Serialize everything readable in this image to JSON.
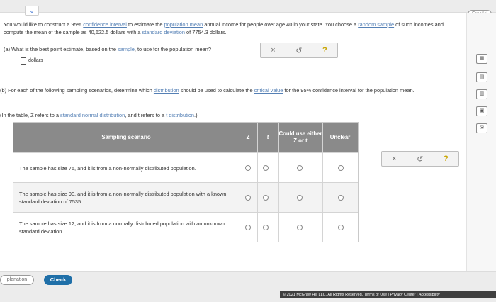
{
  "header": {
    "language_button": "Español"
  },
  "intro": {
    "p1": "You would like to construct a 95% ",
    "link1": "confidence interval",
    "p2": " to estimate the ",
    "link2": "population mean",
    "p3": " annual income for people over age 40 in your state. You choose a ",
    "link3": "random sample",
    "p4": " of such incomes and compute the mean of the sample as 40,622.5 dollars with a ",
    "link4": "standard deviation",
    "p5": " of 7754.3 dollars."
  },
  "part_a": {
    "q1": "(a) What is the best point estimate, based on the ",
    "link": "sample",
    "q2": ", to use for the population mean?",
    "unit": "dollars"
  },
  "tools": {
    "clear": "×",
    "undo": "↺",
    "help": "?"
  },
  "part_b": {
    "q1": "(b) For each of the following sampling scenarios, determine which ",
    "link1": "distribution",
    "q2": " should be used to calculate the ",
    "link2": "critical value",
    "q3": " for the 95% confidence interval for the population mean.",
    "note1": "(In the table, Z refers to a ",
    "note_link1": "standard normal distribution",
    "note2": ", and t refers to a ",
    "note_link2": "t distribution",
    "note3": ".)"
  },
  "table": {
    "headers": {
      "scenario": "Sampling scenario",
      "z": "Z",
      "t": "t",
      "either": "Could use either Z or t",
      "unclear": "Unclear"
    },
    "rows": [
      {
        "text": "The sample has size 75, and it is from a non-normally distributed population."
      },
      {
        "text": "The sample has size 90, and it is from a non-normally distributed population with a known standard deviation of 7535."
      },
      {
        "text": "The sample has size 12, and it is from a normally distributed population with an unknown standard deviation."
      }
    ]
  },
  "bottom": {
    "explanation_button": "planation",
    "check_button": "Check",
    "footer": "© 2021 McGraw Hill LLC. All Rights Reserved.   Terms of Use   |   Privacy Center   |   Accessibility"
  },
  "icons": [
    "chevron-down-icon",
    "data-icon",
    "calculator-icon",
    "periodic-table-icon",
    "envelope-icon"
  ],
  "colors": {
    "header_gray": "#8a8a8a",
    "check_blue": "#1f6fa8",
    "link_blue": "#5580b5",
    "help_gold": "#c9a500"
  }
}
